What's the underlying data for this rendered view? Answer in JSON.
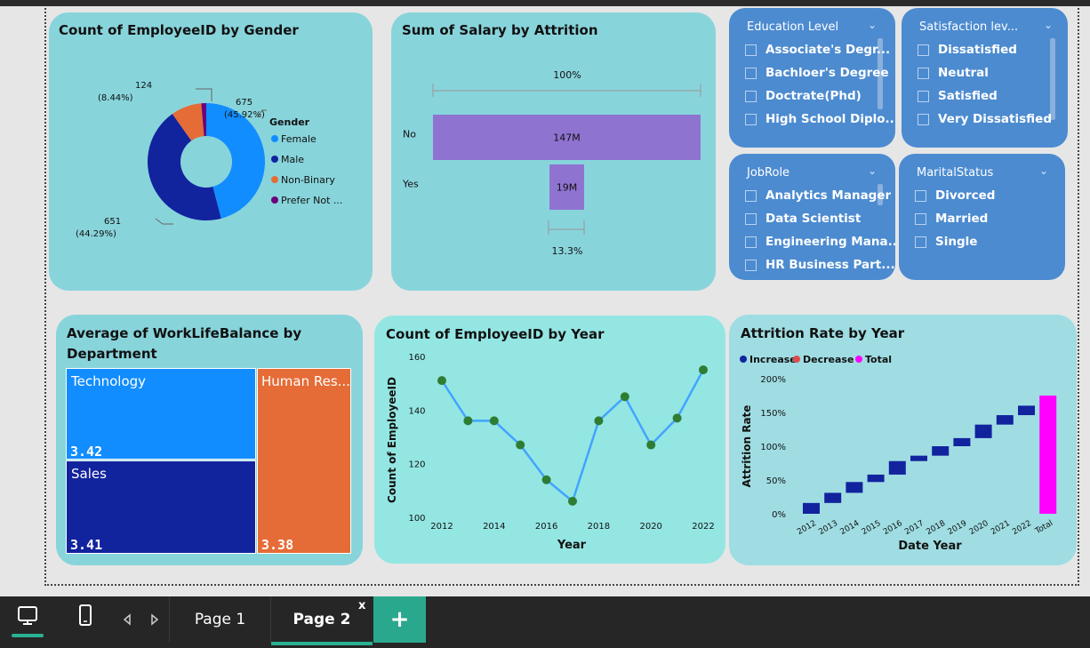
{
  "gender_chart": {
    "title": "Count of EmployeeID by Gender",
    "legend_title": "Gender",
    "chart_data": {
      "type": "pie",
      "slices": [
        {
          "name": "Female",
          "value": 675,
          "label": "675",
          "pct": "(45.92%)",
          "color": "#118dff"
        },
        {
          "name": "Male",
          "value": 651,
          "label": "651",
          "pct": "(44.29%)",
          "color": "#12239e"
        },
        {
          "name": "Non-Binary",
          "value": 124,
          "label": "124",
          "pct": "(8.44%)",
          "color": "#e66c37"
        },
        {
          "name": "Prefer Not ...",
          "value": 20,
          "label": "",
          "pct": "",
          "color": "#6b007b"
        }
      ]
    }
  },
  "salary_chart": {
    "title": "Sum of Salary by Attrition",
    "top_pct": "100%",
    "bottom_pct": "13.3%",
    "chart_data": {
      "type": "bar",
      "categories": [
        "No",
        "Yes"
      ],
      "values": [
        147,
        19
      ],
      "labels": [
        "147M",
        "19M"
      ],
      "color": "#8f73d1"
    }
  },
  "slicers": {
    "education": {
      "title": "Education Level",
      "items": [
        "Associate's Degr...",
        "Bachloer's Degree",
        "Doctrate(Phd)",
        "High School Diplo..."
      ]
    },
    "satisfaction": {
      "title": "Satisfaction lev...",
      "items": [
        "Dissatisfied",
        "Neutral",
        "Satisfied",
        "Very Dissatisfied"
      ]
    },
    "jobrole": {
      "title": "JobRole",
      "items": [
        "Analytics Manager",
        "Data Scientist",
        "Engineering Mana...",
        "HR Business Part..."
      ]
    },
    "marital": {
      "title": "MaritalStatus",
      "items": [
        "Divorced",
        "Married",
        "Single"
      ]
    }
  },
  "wlb_chart": {
    "title_line1": "Average of WorkLifeBalance by",
    "title_line2": "Department",
    "chart_data": {
      "type": "treemap",
      "items": [
        {
          "name": "Technology",
          "value": 3.42,
          "label": "3.42",
          "color": "#118dff"
        },
        {
          "name": "Sales",
          "value": 3.41,
          "label": "3.41",
          "color": "#12239e"
        },
        {
          "name": "Human Res...",
          "value": 3.38,
          "label": "3.38",
          "color": "#e66c37"
        }
      ]
    }
  },
  "year_chart": {
    "title": "Count of EmployeeID by Year",
    "xlabel": "Year",
    "ylabel": "Count of EmployeeID",
    "chart_data": {
      "type": "line",
      "x": [
        2012,
        2013,
        2014,
        2015,
        2016,
        2017,
        2018,
        2019,
        2020,
        2021,
        2022
      ],
      "y": [
        151,
        136,
        136,
        127,
        114,
        106,
        136,
        145,
        127,
        137,
        155
      ],
      "xticks": [
        "2012",
        "2014",
        "2016",
        "2018",
        "2020",
        "2022"
      ],
      "yticks": [
        "100",
        "120",
        "140",
        "160"
      ],
      "ylim": [
        100,
        160
      ],
      "line_color": "#41a4ff",
      "marker_color": "#2e7d32"
    }
  },
  "attrition_chart": {
    "title": "Attrition Rate by Year",
    "xlabel": "Date Year",
    "ylabel": "Attrition Rate",
    "legend": [
      {
        "label": "Increase",
        "color": "#12239e"
      },
      {
        "label": "Decrease",
        "color": "#e04a4a"
      },
      {
        "label": "Total",
        "color": "#ff00ff"
      }
    ],
    "chart_data": {
      "type": "waterfall",
      "categories": [
        "2012",
        "2013",
        "2014",
        "2015",
        "2016",
        "2017",
        "2018",
        "2019",
        "2020",
        "2021",
        "2022",
        "Total"
      ],
      "steps": [
        16,
        15,
        16,
        11,
        20,
        8,
        14,
        12,
        20,
        14,
        14
      ],
      "total": 175,
      "yticks": [
        "0%",
        "50%",
        "100%",
        "150%",
        "200%"
      ],
      "ylim": [
        0,
        200
      ]
    }
  },
  "bottom": {
    "tabs": [
      "Page 1",
      "Page 2"
    ],
    "close_label": "x",
    "add_label": "+"
  }
}
